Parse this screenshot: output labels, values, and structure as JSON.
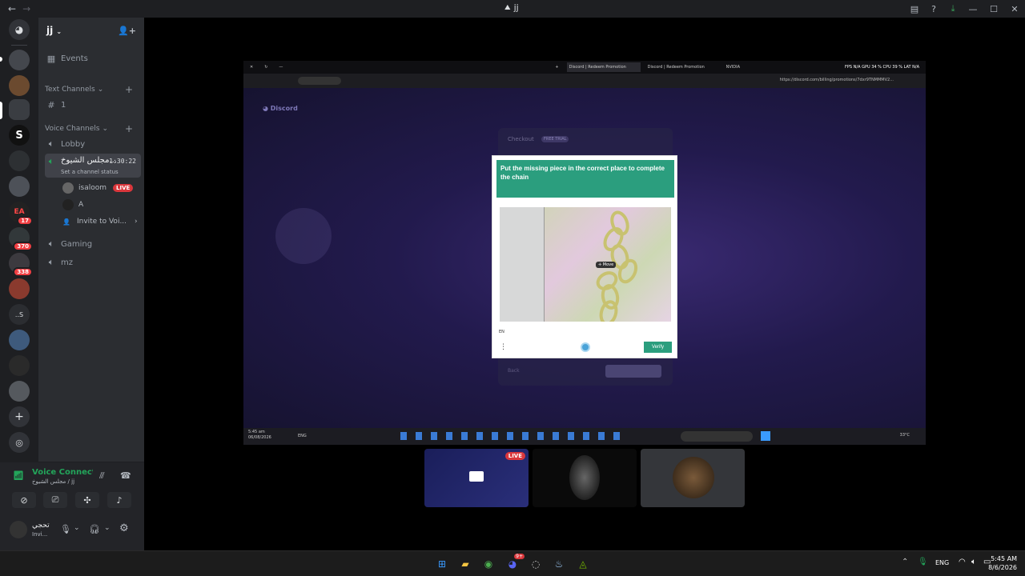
{
  "window": {
    "title": "jj",
    "colors": {
      "bg": "#000000",
      "sidebar": "#2b2d31",
      "accent": "#5865f2",
      "live": "#da373c",
      "captcha_green": "#2b9e7e"
    }
  },
  "server": {
    "name": "jj",
    "events_label": "Events",
    "text_category": "Text Channels",
    "text_channels": [
      "1"
    ],
    "voice_category": "Voice Channels",
    "voice_channels": {
      "lobby": "Lobby",
      "active": "مجلس الشيوخ...",
      "active_timer": "1:30:22",
      "active_status": "Set a channel status",
      "gaming": "Gaming",
      "mz": "mz"
    },
    "voice_users": [
      {
        "name": "isaloom",
        "badge": "LIVE"
      },
      {
        "name": "A"
      }
    ],
    "invite_label": "Invite to Voi..."
  },
  "guild_badges": [
    "17",
    "370",
    "338"
  ],
  "guild_text": [
    "S",
    "..S"
  ],
  "voice_panel": {
    "status": "Voice Connected",
    "location": "مجلس الشيوخ / jj"
  },
  "user_panel": {
    "name": "تحجي",
    "status": "Invi..."
  },
  "stream": {
    "tabs": [
      "Discord | Redeem Promotion",
      "Discord | Redeem Promotion",
      "NVIDIA"
    ],
    "overlay": "FPS N/A GPU 34 % CPU 39 % LAT N/A",
    "url": "https://discord.com/billing/promotions/7dxr9TNMMMV2...",
    "page_brand": "Discord",
    "checkout_title": "Checkout",
    "checkout_badge": "FREE TRIAL",
    "back_label": "Back",
    "captcha": {
      "instruction": "Put the missing piece in the correct place to complete the chain",
      "move_label": "Move",
      "lang": "EN",
      "verify": "Verify"
    },
    "inner_time": "5:45 am",
    "inner_date": "06/08/2026",
    "inner_lang": "ENG",
    "inner_weather": "33°C"
  },
  "thumbs": [
    {
      "label": "LIVE"
    }
  ],
  "taskbar": {
    "lang": "ENG",
    "time": "5:45 AM",
    "date": "8/6/2026",
    "discord_badge": "9+"
  }
}
